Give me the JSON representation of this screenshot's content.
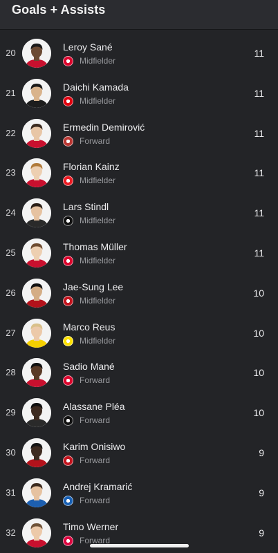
{
  "header": {
    "title": "Goals + Assists"
  },
  "players": [
    {
      "rank": "20",
      "name": "Leroy Sané",
      "position": "Midfielder",
      "value": "11",
      "club_icon": "bayern-munich-badge-icon",
      "club_color": "#dc052d"
    },
    {
      "rank": "21",
      "name": "Daichi Kamada",
      "position": "Midfielder",
      "value": "11",
      "club_icon": "eintracht-frankfurt-badge-icon",
      "club_color": "#e1000f"
    },
    {
      "rank": "22",
      "name": "Ermedin Demirović",
      "position": "Forward",
      "value": "11",
      "club_icon": "augsburg-badge-icon",
      "club_color": "#ba3733"
    },
    {
      "rank": "23",
      "name": "Florian Kainz",
      "position": "Midfielder",
      "value": "11",
      "club_icon": "koln-badge-icon",
      "club_color": "#ed1c24"
    },
    {
      "rank": "24",
      "name": "Lars Stindl",
      "position": "Midfielder",
      "value": "11",
      "club_icon": "gladbach-badge-icon",
      "club_color": "#111111"
    },
    {
      "rank": "25",
      "name": "Thomas Müller",
      "position": "Midfielder",
      "value": "11",
      "club_icon": "bayern-munich-badge-icon",
      "club_color": "#dc052d"
    },
    {
      "rank": "26",
      "name": "Jae-Sung Lee",
      "position": "Midfielder",
      "value": "10",
      "club_icon": "mainz-badge-icon",
      "club_color": "#c3141e"
    },
    {
      "rank": "27",
      "name": "Marco Reus",
      "position": "Midfielder",
      "value": "10",
      "club_icon": "dortmund-badge-icon",
      "club_color": "#fde100"
    },
    {
      "rank": "28",
      "name": "Sadio Mané",
      "position": "Forward",
      "value": "10",
      "club_icon": "bayern-munich-badge-icon",
      "club_color": "#dc052d"
    },
    {
      "rank": "29",
      "name": "Alassane Pléa",
      "position": "Forward",
      "value": "10",
      "club_icon": "gladbach-badge-icon",
      "club_color": "#111111"
    },
    {
      "rank": "30",
      "name": "Karim Onisiwo",
      "position": "Forward",
      "value": "9",
      "club_icon": "mainz-badge-icon",
      "club_color": "#c3141e"
    },
    {
      "rank": "31",
      "name": "Andrej Kramarić",
      "position": "Forward",
      "value": "9",
      "club_icon": "hoffenheim-badge-icon",
      "club_color": "#1961b5"
    },
    {
      "rank": "32",
      "name": "Timo Werner",
      "position": "Forward",
      "value": "9",
      "club_icon": "leipzig-badge-icon",
      "club_color": "#dd0741"
    }
  ]
}
